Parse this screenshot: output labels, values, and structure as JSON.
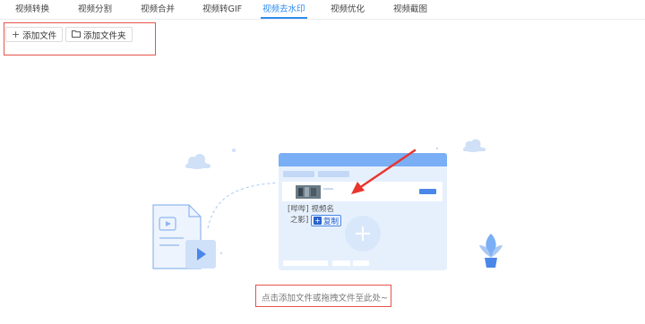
{
  "tabs": [
    {
      "label": "视频转换"
    },
    {
      "label": "视频分割"
    },
    {
      "label": "视频合并"
    },
    {
      "label": "视频转GIF"
    },
    {
      "label": "视频去水印"
    },
    {
      "label": "视频优化"
    },
    {
      "label": "视频截图"
    }
  ],
  "active_tab": "视频去水印",
  "toolbar": {
    "add_file_icon": "plus-icon",
    "add_file_label": "添加文件",
    "add_folder_icon": "folder-icon",
    "add_folder_label": "添加文件夹"
  },
  "drop_zone": {
    "thumb_text_line1": "[哔哔] 视频名",
    "thumb_text_line2": "之影]",
    "copy_label": "复制",
    "hint": "点击添加文件或拖拽文件至此处~"
  },
  "colors": {
    "accent": "#2d8cf0",
    "highlight_frame": "#e8534a",
    "illustration_blue": "#7aaef5",
    "illustration_light": "#e6f0fd"
  }
}
